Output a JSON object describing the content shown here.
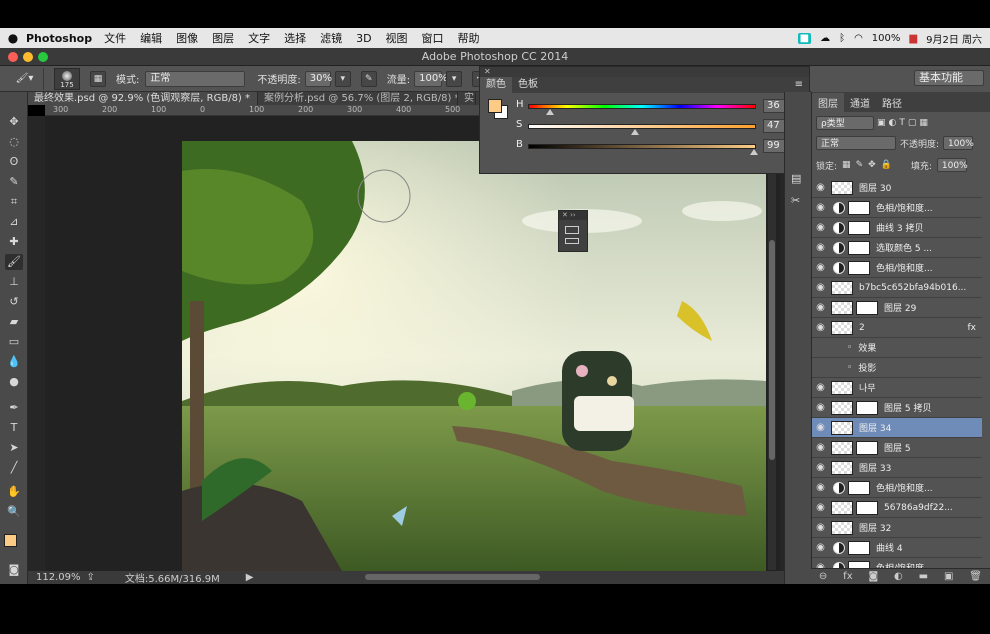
{
  "menubar": {
    "app_name": "Photoshop",
    "items": [
      "文件",
      "编辑",
      "图像",
      "图层",
      "文字",
      "选择",
      "滤镜",
      "3D",
      "视图",
      "窗口",
      "帮助"
    ],
    "battery": "100%",
    "datetime": "9月2日 周六"
  },
  "window": {
    "title": "Adobe Photoshop CC 2014"
  },
  "options": {
    "brush_size": "175",
    "mode_label": "模式:",
    "mode_value": "正常",
    "opacity_label": "不透明度:",
    "opacity_value": "30%",
    "flow_label": "流量:",
    "flow_value": "100%",
    "workspace": "基本功能"
  },
  "doc_tabs": [
    {
      "label": "最终效果.psd @ 92.9% (色调观察层, RGB/8) *"
    },
    {
      "label": "案例分析.psd @ 56.7% (图层 2, RGB/8) *"
    },
    {
      "label": "实"
    }
  ],
  "ruler": [
    "300",
    "200",
    "100",
    "0",
    "100",
    "200",
    "300",
    "400",
    "500"
  ],
  "status": {
    "zoom": "112.09%",
    "doc": "文档:5.66M/316.9M"
  },
  "color_panel": {
    "tabs": [
      "颜色",
      "色板"
    ],
    "rows": [
      {
        "label": "H",
        "value": "36",
        "unit": "°",
        "fraction": 0.1
      },
      {
        "label": "S",
        "value": "47",
        "unit": "%",
        "fraction": 0.47
      },
      {
        "label": "B",
        "value": "99",
        "unit": "%",
        "fraction": 0.99
      }
    ],
    "foreground": "#fccc86"
  },
  "layers_panel": {
    "tabs": [
      "图层",
      "通道",
      "路径"
    ],
    "filter": "ρ类型",
    "blend_mode": "正常",
    "opacity_label": "不透明度:",
    "opacity_value": "100%",
    "lock_label": "锁定:",
    "fill_label": "填充:",
    "fill_value": "100%",
    "layers": [
      {
        "name": "图层 30",
        "kind": "pixel"
      },
      {
        "name": "色相/饱和度...",
        "kind": "adj"
      },
      {
        "name": "曲线 3 拷贝",
        "kind": "adj"
      },
      {
        "name": "选取颜色 5 ...",
        "kind": "adj"
      },
      {
        "name": "色相/饱和度...",
        "kind": "adj"
      },
      {
        "name": "b7bc5c652bfa94b016...",
        "kind": "smart"
      },
      {
        "name": "图层 29",
        "kind": "mask"
      },
      {
        "name": "2",
        "kind": "smart",
        "fx": "fx"
      },
      {
        "name": "效果",
        "kind": "effect"
      },
      {
        "name": "投影",
        "kind": "effect"
      },
      {
        "name": "나무",
        "kind": "pixel"
      },
      {
        "name": "图层 5 拷贝",
        "kind": "mask"
      },
      {
        "name": "图层 34",
        "kind": "pixel",
        "selected": true
      },
      {
        "name": "图层 5",
        "kind": "mask"
      },
      {
        "name": "图层 33",
        "kind": "pixel"
      },
      {
        "name": "色相/饱和度...",
        "kind": "adj"
      },
      {
        "name": "56786a9df22...",
        "kind": "mask"
      },
      {
        "name": "图层 32",
        "kind": "pixel"
      },
      {
        "name": "曲线 4",
        "kind": "adj"
      },
      {
        "name": "色相/饱和度...",
        "kind": "adj"
      }
    ]
  }
}
